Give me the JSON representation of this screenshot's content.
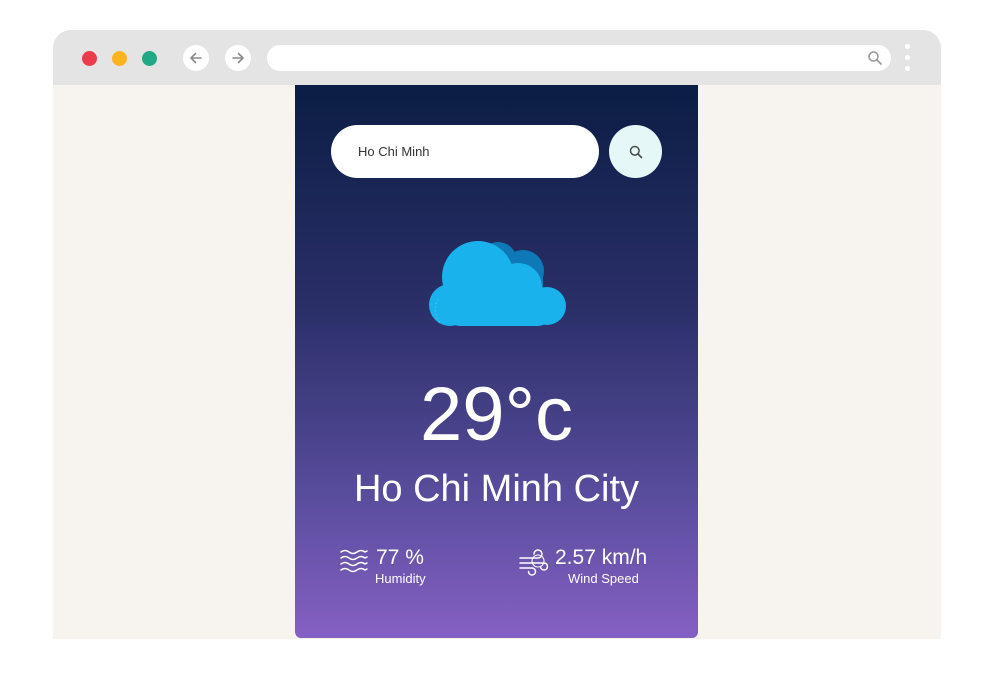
{
  "search": {
    "value": "Ho Chi Minh"
  },
  "weather": {
    "icon": "cloud-icon",
    "temperature": "29°c",
    "city": "Ho Chi Minh City"
  },
  "humidity": {
    "value": "77 %",
    "label": "Humidity",
    "icon": "humidity-icon"
  },
  "wind": {
    "value": "2.57 km/h",
    "label": "Wind Speed",
    "icon": "wind-icon"
  },
  "colors": {
    "card_top": "#0b1d44",
    "card_bottom": "#8560c3",
    "cloud_front": "#1ab2ec",
    "cloud_back": "#0f78b6",
    "close_dot": "#ee3b4b",
    "minimize_dot": "#fbb321",
    "maximize_dot": "#22a884"
  }
}
